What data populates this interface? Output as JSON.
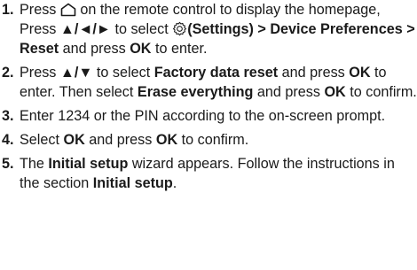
{
  "steps": [
    {
      "number": "1.",
      "parts": [
        "Press ",
        "home-icon",
        " on the remote control to display the homepage, Press ",
        "▲/◄/►",
        " to select ",
        "gear-icon",
        "(Settings) > Device Preferences > Reset",
        " and press ",
        "OK",
        " to enter."
      ]
    },
    {
      "number": "2.",
      "parts": [
        "Press ",
        "▲/▼",
        " to select ",
        "Factory data reset",
        " and press ",
        "OK",
        " to enter. Then select ",
        "Erase everything",
        " and press ",
        "OK",
        " to confirm."
      ]
    },
    {
      "number": "3.",
      "parts": [
        "Enter 1234 or the PIN according to the on-screen prompt."
      ]
    },
    {
      "number": "4.",
      "parts": [
        "Select ",
        "OK",
        " and press ",
        "OK",
        " to confirm."
      ]
    },
    {
      "number": "5.",
      "parts": [
        "The ",
        "Initial setup",
        " wizard appears. Follow the instructions in the section ",
        "Initial setup",
        "."
      ]
    }
  ]
}
